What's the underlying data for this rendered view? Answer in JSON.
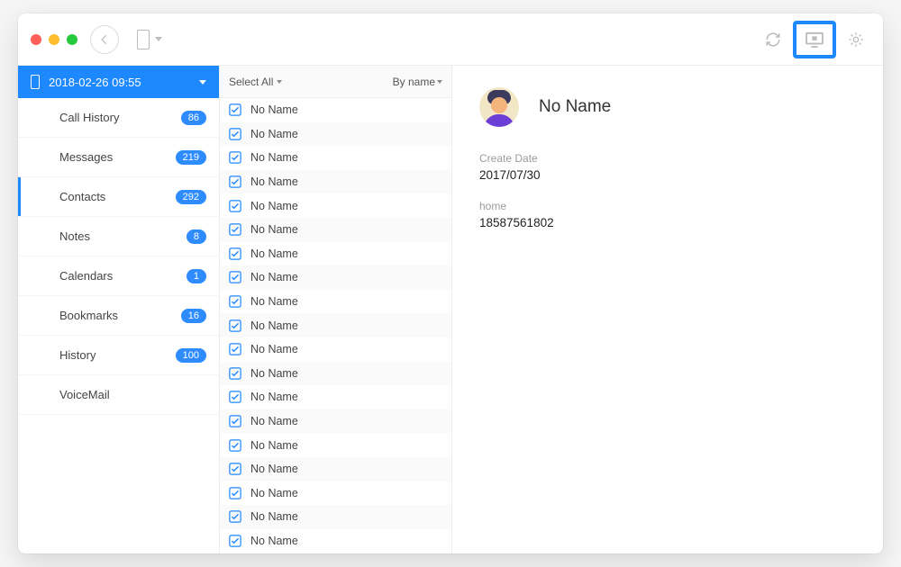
{
  "titlebar": {
    "refresh_icon": "refresh-icon",
    "export_icon": "monitor-export-icon",
    "settings_icon": "gear-icon"
  },
  "sidebar": {
    "header_label": "2018-02-26 09:55",
    "items": [
      {
        "label": "Call History",
        "badge": "86",
        "active": false
      },
      {
        "label": "Messages",
        "badge": "219",
        "active": false
      },
      {
        "label": "Contacts",
        "badge": "292",
        "active": true
      },
      {
        "label": "Notes",
        "badge": "8",
        "active": false
      },
      {
        "label": "Calendars",
        "badge": "1",
        "active": false
      },
      {
        "label": "Bookmarks",
        "badge": "16",
        "active": false
      },
      {
        "label": "History",
        "badge": "100",
        "active": false
      },
      {
        "label": "VoiceMail",
        "badge": "",
        "active": false
      }
    ]
  },
  "list": {
    "select_all_label": "Select All",
    "sort_label": "By name",
    "rows": [
      "No Name",
      "No Name",
      "No Name",
      "No Name",
      "No Name",
      "No Name",
      "No Name",
      "No Name",
      "No Name",
      "No Name",
      "No Name",
      "No Name",
      "No Name",
      "No Name",
      "No Name",
      "No Name",
      "No Name",
      "No Name",
      "No Name"
    ]
  },
  "detail": {
    "name": "No Name",
    "create_label": "Create Date",
    "create_value": "2017/07/30",
    "phone_label": "home",
    "phone_value": "18587561802"
  }
}
